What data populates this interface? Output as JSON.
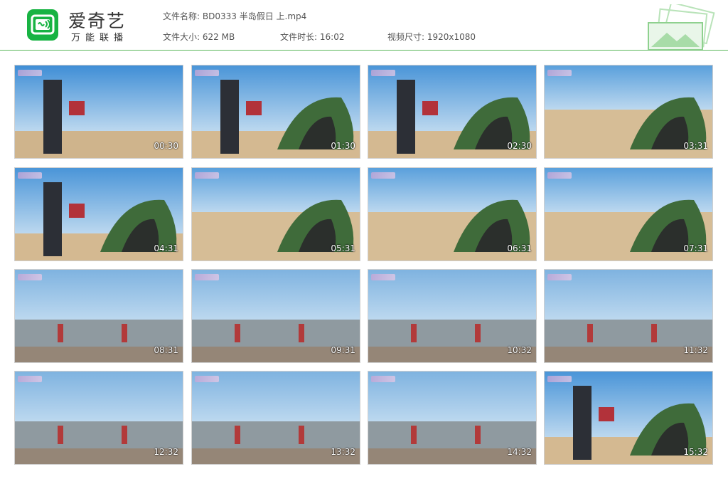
{
  "brand": {
    "title": "爱奇艺",
    "subtitle": "万能联播"
  },
  "file": {
    "name_label": "文件名称:",
    "name_value": "BD0333 半岛假日 上.mp4",
    "size_label": "文件大小:",
    "size_value": "622 MB",
    "duration_label": "文件时长:",
    "duration_value": "16:02",
    "dims_label": "视频尺寸:",
    "dims_value": "1920x1080"
  },
  "colors": {
    "accent": "#18b343",
    "rule": "#5cb85c"
  },
  "thumbnails": [
    {
      "time": "00:30",
      "scene": "beach-people"
    },
    {
      "time": "01:30",
      "scene": "beach-tent-people"
    },
    {
      "time": "02:30",
      "scene": "beach-tent-people"
    },
    {
      "time": "03:31",
      "scene": "beach-tent"
    },
    {
      "time": "04:31",
      "scene": "beach-tent-people"
    },
    {
      "time": "05:31",
      "scene": "beach-tent"
    },
    {
      "time": "06:31",
      "scene": "beach-tent"
    },
    {
      "time": "07:31",
      "scene": "beach-tent"
    },
    {
      "time": "08:31",
      "scene": "sea-people"
    },
    {
      "time": "09:31",
      "scene": "sea-people"
    },
    {
      "time": "10:32",
      "scene": "sea-people"
    },
    {
      "time": "11:32",
      "scene": "sea-people"
    },
    {
      "time": "12:32",
      "scene": "sea-people"
    },
    {
      "time": "13:32",
      "scene": "sea-people"
    },
    {
      "time": "14:32",
      "scene": "sea-people"
    },
    {
      "time": "15:32",
      "scene": "beach-tent-people"
    }
  ]
}
